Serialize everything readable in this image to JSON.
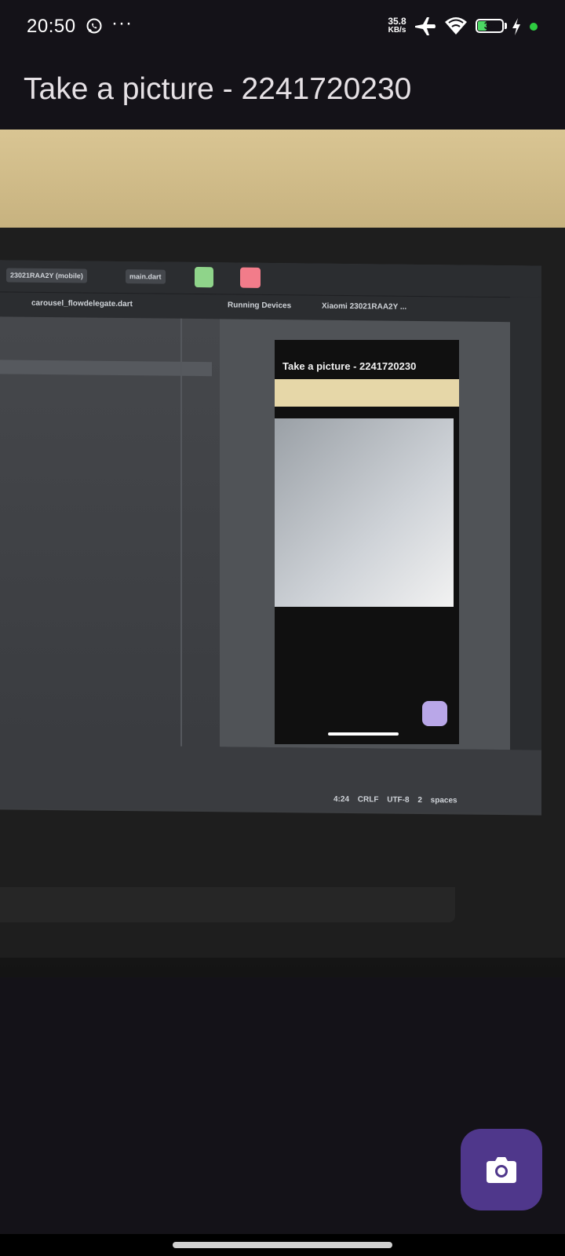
{
  "status_bar": {
    "time": "20:50",
    "net_speed_value": "35.8",
    "net_speed_unit": "KB/s",
    "battery_level": "35",
    "battery_fraction": 0.35,
    "icons": [
      "whatsapp-icon",
      "more-dots",
      "airplane-icon",
      "wifi-icon",
      "battery-icon",
      "charging-bolt-icon",
      "notification-dot"
    ],
    "battery_color": "#4cd964",
    "notif_dot_color": "#2ecc40"
  },
  "app_bar": {
    "title": "Take a picture - 2241720230"
  },
  "preview": {
    "ide": {
      "device_chip": "23021RAA2Y (mobile)",
      "file_chip": "main.dart",
      "editor_tab": "carousel_flowdelegate.dart",
      "running_devices_tab": "Running Devices",
      "device_tab": "Xiaomi 23021RAA2Y ...",
      "status_line": "4:24 CRLF UTF-8 2 spaces"
    },
    "mirrored_app_title": "Take a picture - 2241720230"
  },
  "fab": {
    "icon": "camera-icon",
    "color": "#4f378b"
  },
  "colors": {
    "background": "#141218",
    "on_surface": "#e6e1e5",
    "primary_container": "#4f378b"
  }
}
